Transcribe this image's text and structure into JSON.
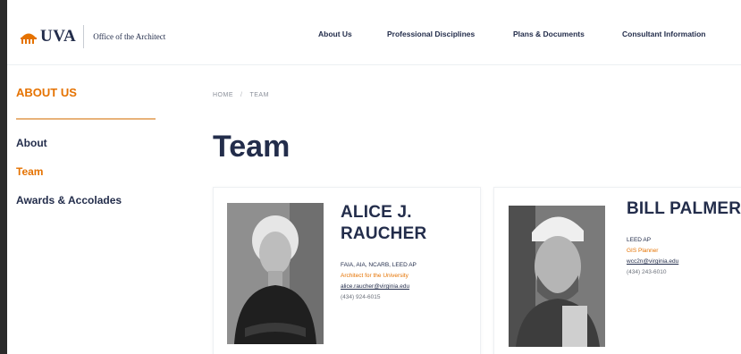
{
  "header": {
    "logo_text": "UVA",
    "logo_subtitle": "Office of the Architect",
    "nav": [
      "About Us",
      "Professional Disciplines",
      "Plans & Documents",
      "Consultant Information"
    ]
  },
  "sidebar": {
    "title": "ABOUT US",
    "items": [
      {
        "label": "About",
        "active": false
      },
      {
        "label": "Team",
        "active": true
      },
      {
        "label": "Awards & Accolades",
        "active": false
      }
    ]
  },
  "breadcrumb": [
    "HOME",
    "TEAM"
  ],
  "page_title": "Team",
  "team": [
    {
      "name_line1": "ALICE J.",
      "name_line2": "RAUCHER",
      "credentials": "FAIA, AIA, NCARB, LEED AP",
      "role": "Architect for the University",
      "email": "alice.raucher@virginia.edu",
      "phone": "(434) 924-6015"
    },
    {
      "name_line1": "BILL PALMER",
      "credentials": "LEED AP",
      "role": "GIS Planner",
      "email": "wcc2n@virginia.edu",
      "phone": "(434) 243-6010"
    }
  ],
  "colors": {
    "navy": "#232d4b",
    "orange": "#e57200"
  }
}
